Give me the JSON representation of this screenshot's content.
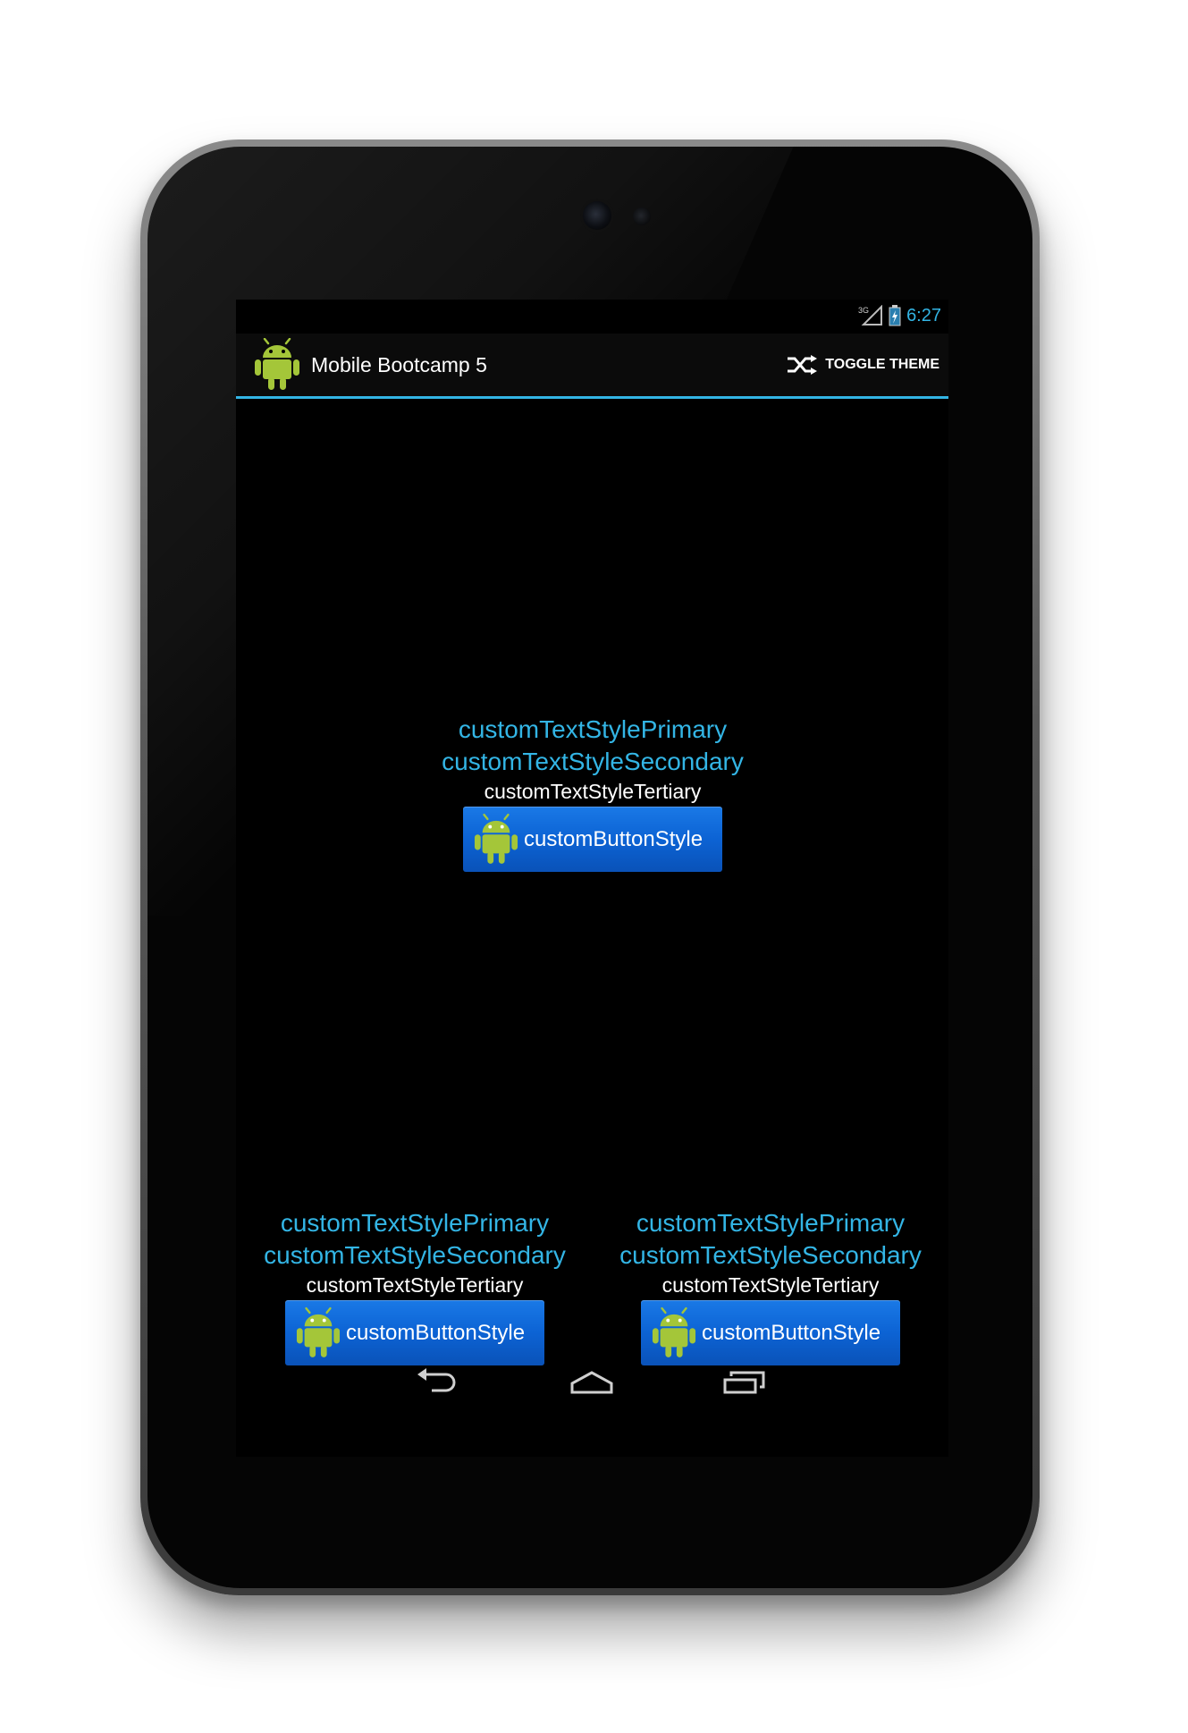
{
  "status_bar": {
    "network": "3G",
    "time": "6:27"
  },
  "action_bar": {
    "app_title": "Mobile Bootcamp 5",
    "toggle_theme_label": "TOGGLE THEME"
  },
  "style_groups": [
    {
      "primary": "customTextStylePrimary",
      "secondary": "customTextStyleSecondary",
      "tertiary": "customTextStyleTertiary",
      "button_label": "customButtonStyle"
    },
    {
      "primary": "customTextStylePrimary",
      "secondary": "customTextStyleSecondary",
      "tertiary": "customTextStyleTertiary",
      "button_label": "customButtonStyle"
    },
    {
      "primary": "customTextStylePrimary",
      "secondary": "customTextStyleSecondary",
      "tertiary": "customTextStyleTertiary",
      "button_label": "customButtonStyle"
    }
  ],
  "colors": {
    "accent": "#33b5e5",
    "button": "#0c63d4",
    "android_green": "#a4c639"
  },
  "icons": {
    "app": "android-robot-icon",
    "toggle": "shuffle-icon",
    "nav": [
      "back-icon",
      "home-icon",
      "recent-apps-icon"
    ]
  }
}
